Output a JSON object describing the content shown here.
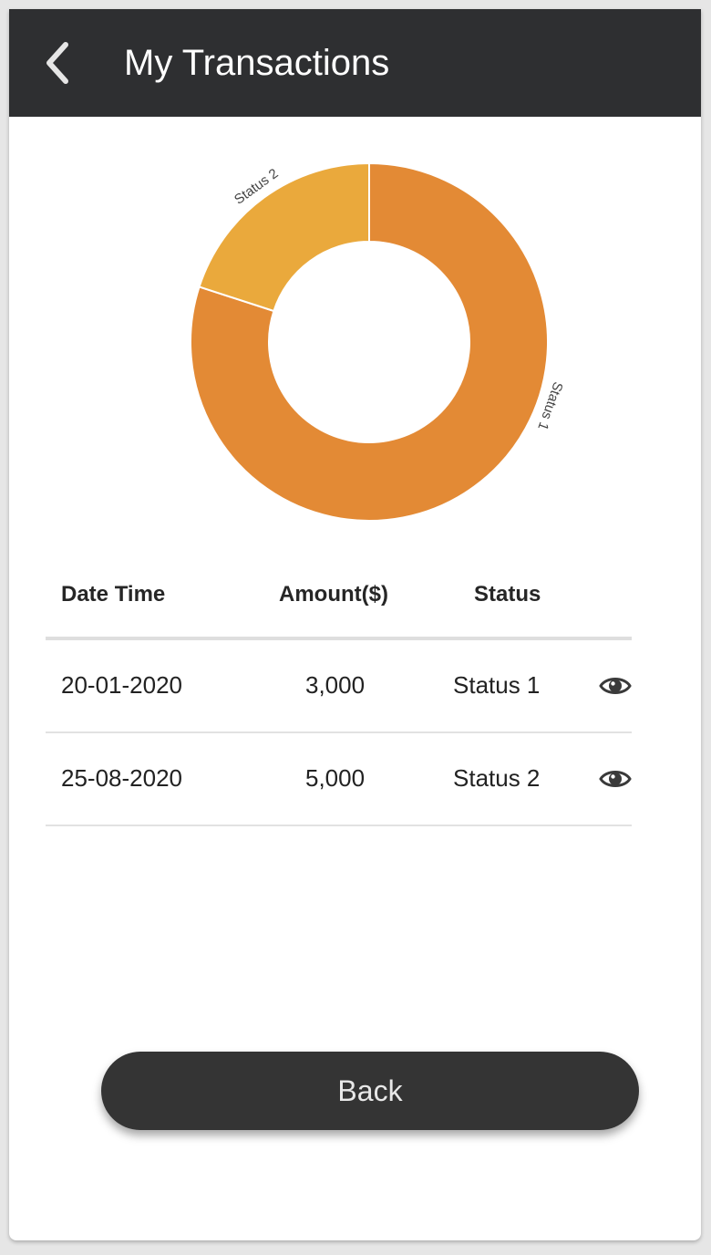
{
  "header": {
    "title": "My Transactions",
    "back_icon": "chevron-left-icon"
  },
  "chart_data": {
    "type": "pie",
    "variant": "donut",
    "categories": [
      "Status 1",
      "Status 2"
    ],
    "values": [
      80,
      20
    ],
    "colors": [
      "#e38a35",
      "#eaa93c"
    ],
    "labels": [
      "Status 1",
      "Status 2"
    ]
  },
  "table": {
    "headers": [
      "Date Time",
      "Amount($)",
      "Status"
    ],
    "rows": [
      {
        "date": "20-01-2020",
        "amount": "3,000",
        "status": "Status 1",
        "icon": "eye-icon"
      },
      {
        "date": "25-08-2020",
        "amount": "5,000",
        "status": "Status 2",
        "icon": "eye-icon"
      }
    ]
  },
  "footer": {
    "back_label": "Back"
  },
  "colors": {
    "appbar": "#2e2f31",
    "button": "#343434",
    "accent_primary": "#e38a35",
    "accent_secondary": "#eaa93c"
  }
}
